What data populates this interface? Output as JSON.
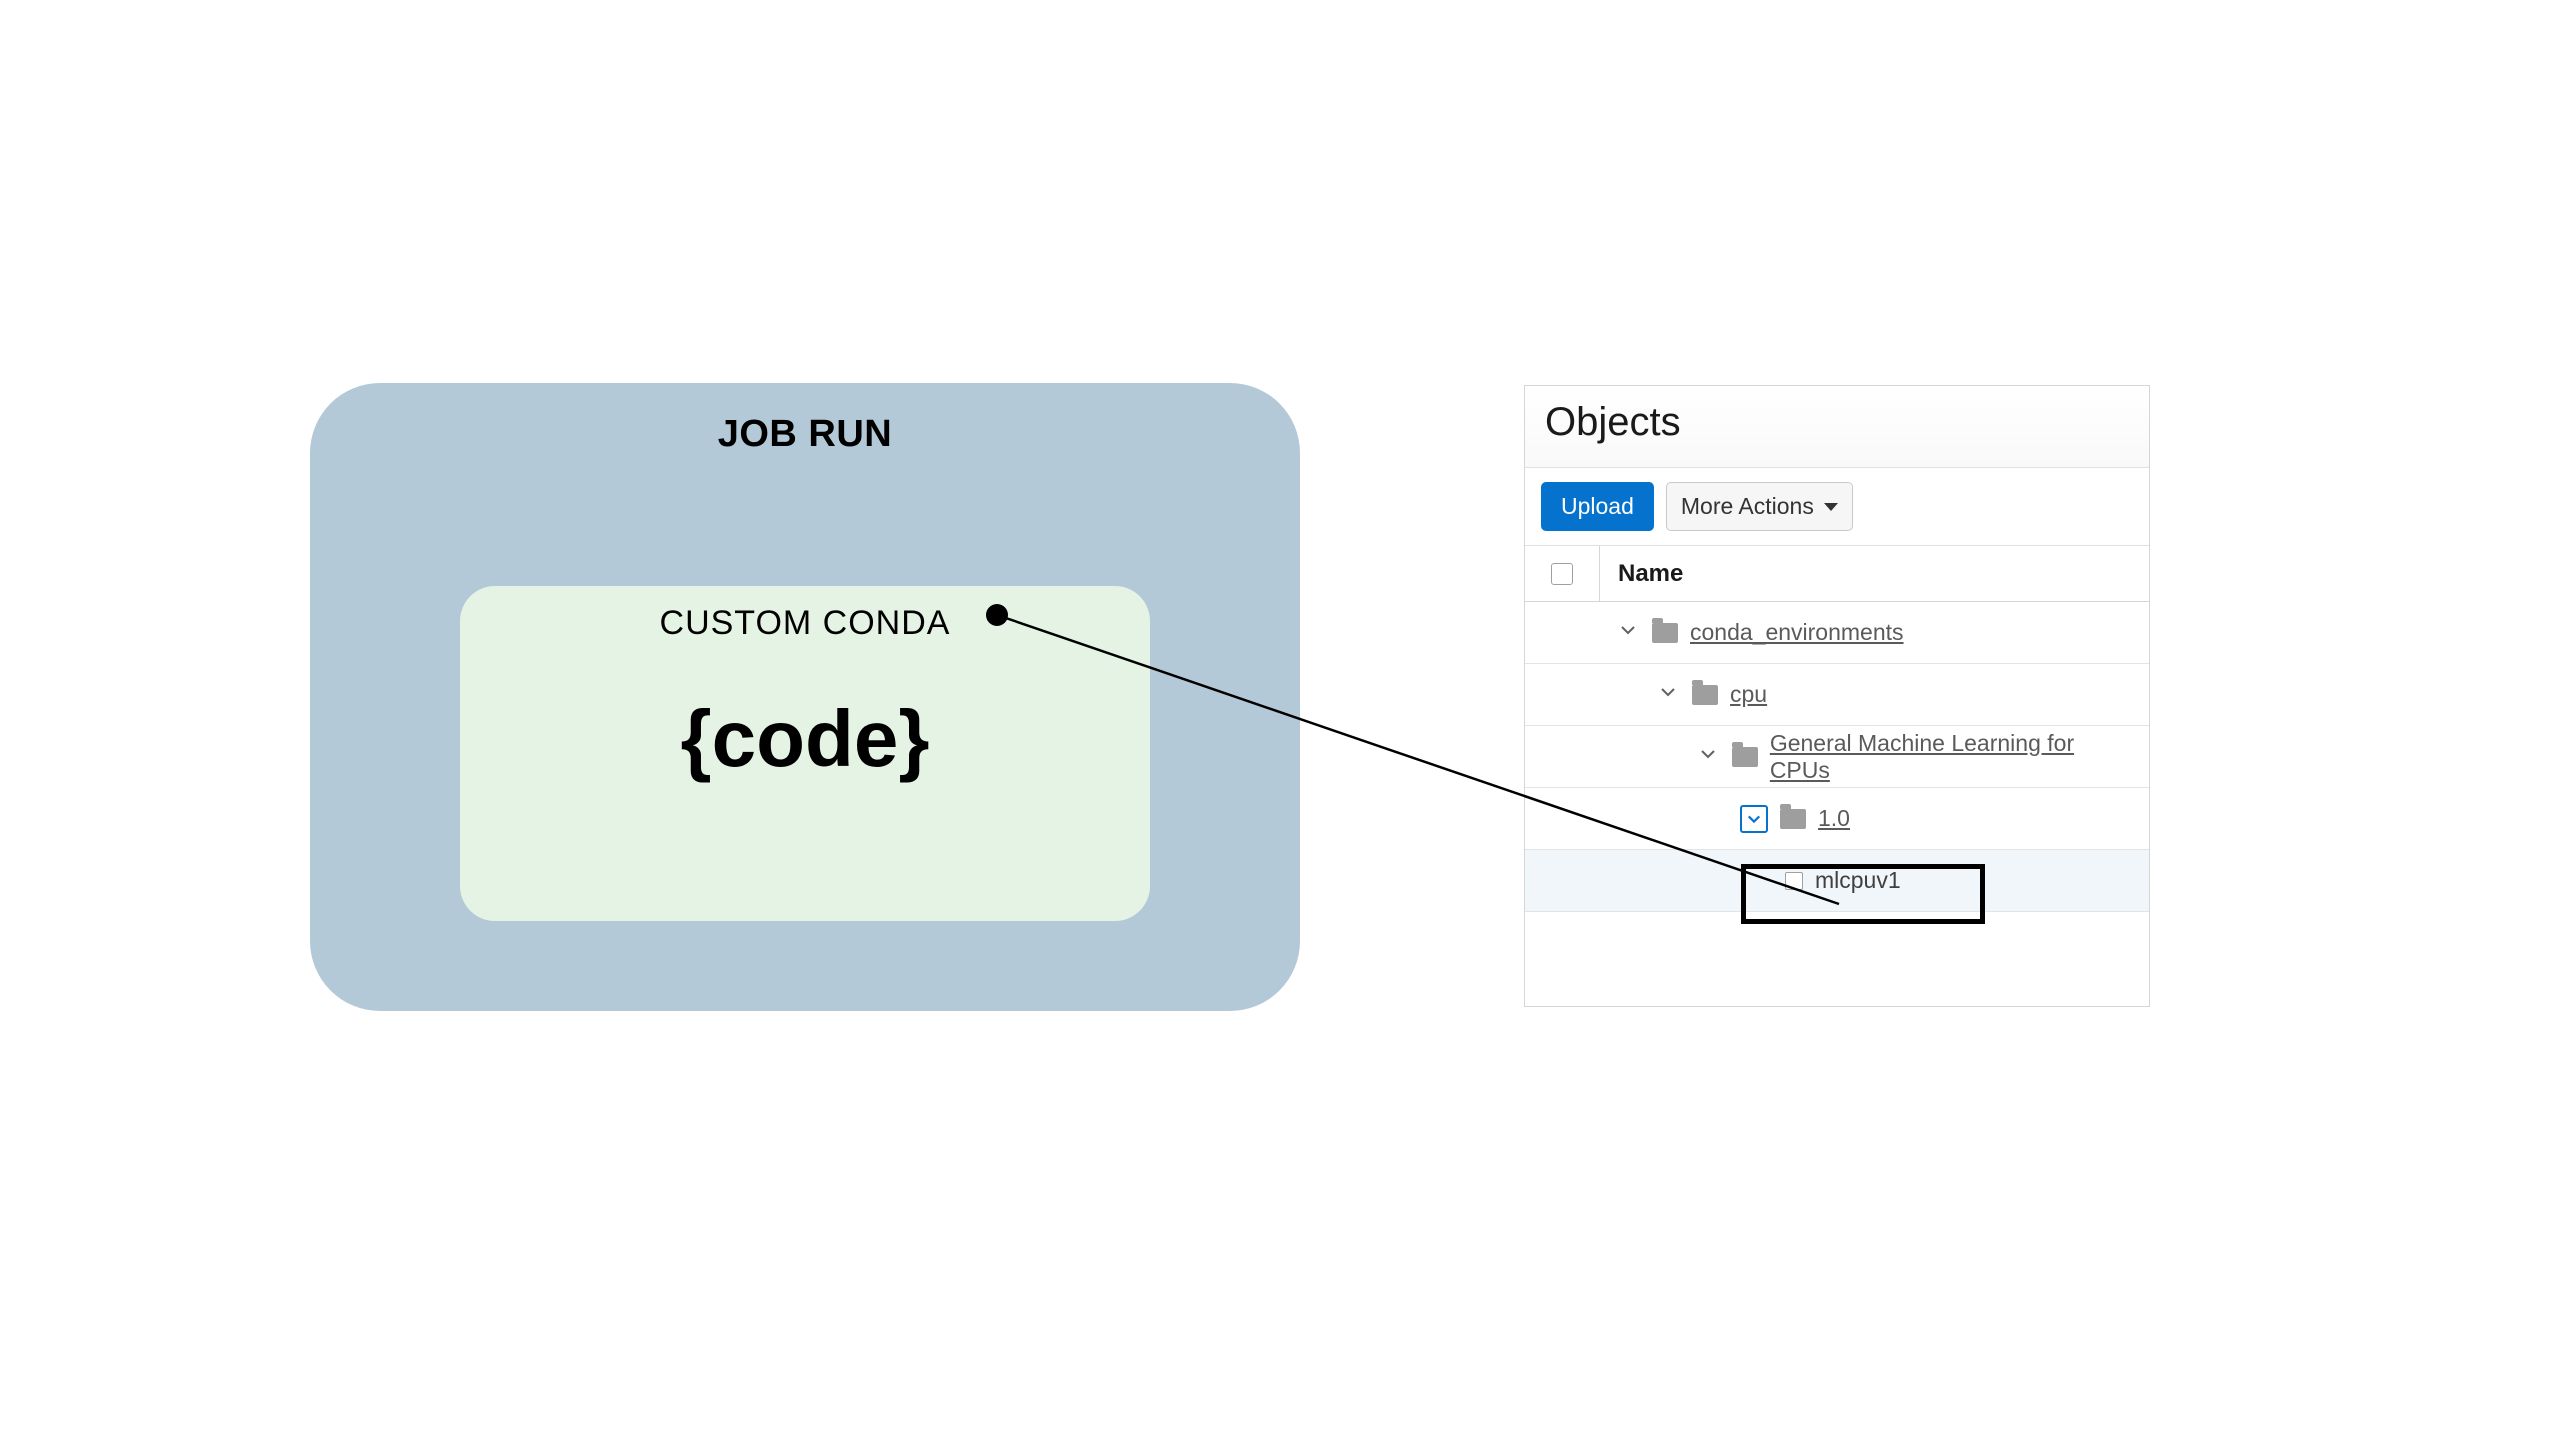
{
  "diagram": {
    "job_run_title": "JOB RUN",
    "custom_conda_title": "CUSTOM CONDA",
    "code_text": "{code}"
  },
  "panel": {
    "title": "Objects",
    "upload_label": "Upload",
    "more_actions_label": "More Actions",
    "name_column": "Name",
    "tree": {
      "item1": "conda_environments",
      "item2": "cpu",
      "item3": "General Machine Learning for CPUs",
      "item4": "1.0",
      "item5": "mlcpuv1"
    }
  }
}
